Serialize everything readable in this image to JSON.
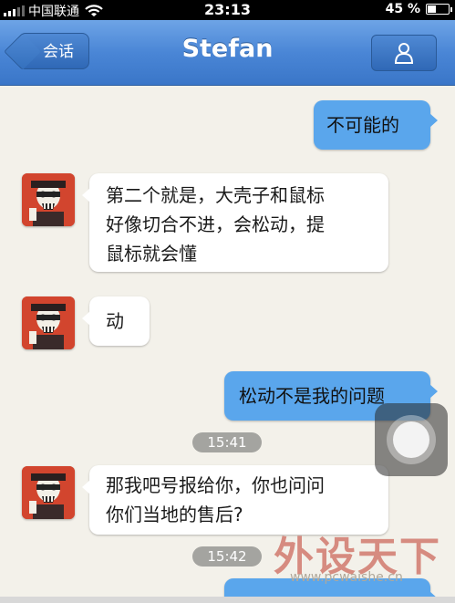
{
  "status_bar": {
    "carrier": "中国联通",
    "time": "23:13",
    "battery_percent": "45 %",
    "battery_level": 0.45
  },
  "nav": {
    "back_label": "会话",
    "title": "Stefan",
    "profile_icon": "person-icon"
  },
  "messages": [
    {
      "direction": "outgoing",
      "text": "不可能的"
    },
    {
      "direction": "incoming",
      "lines": [
        "第二个就是，大壳子和鼠标",
        "好像切合不进，会松动，提",
        "鼠标就会懂"
      ]
    },
    {
      "direction": "incoming",
      "text": "动"
    },
    {
      "direction": "outgoing",
      "text": "松动不是我的问题"
    },
    {
      "type": "timestamp",
      "text": "15:41"
    },
    {
      "direction": "incoming",
      "lines": [
        "那我吧号报给你，你也问问",
        "你们当地的售后?"
      ]
    },
    {
      "type": "timestamp",
      "text": "15:42"
    }
  ],
  "watermark": {
    "title": "外设天下",
    "url": "www.pcwaishe.cn"
  },
  "colors": {
    "nav_blue": "#4a86d6",
    "outgoing_bubble": "#5aa6ec",
    "avatar_red": "#d2452e"
  }
}
